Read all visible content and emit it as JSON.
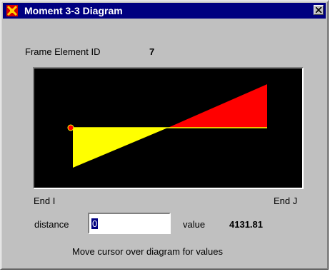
{
  "window": {
    "title": "Moment 3-3 Diagram"
  },
  "frame": {
    "label": "Frame Element ID",
    "id": "7"
  },
  "diagram": {
    "end_i_label": "End I",
    "end_j_label": "End J",
    "colors": {
      "background": "#000000",
      "positive": "#ffff00",
      "negative": "#ff0000",
      "cursor_marker": "#ff0000"
    }
  },
  "distance": {
    "label": "distance",
    "value": "0"
  },
  "value": {
    "label": "value",
    "number": "4131.81"
  },
  "hint": "Move cursor over diagram for values",
  "icons": {
    "app": "sap-logo-icon",
    "close": "close-icon"
  }
}
